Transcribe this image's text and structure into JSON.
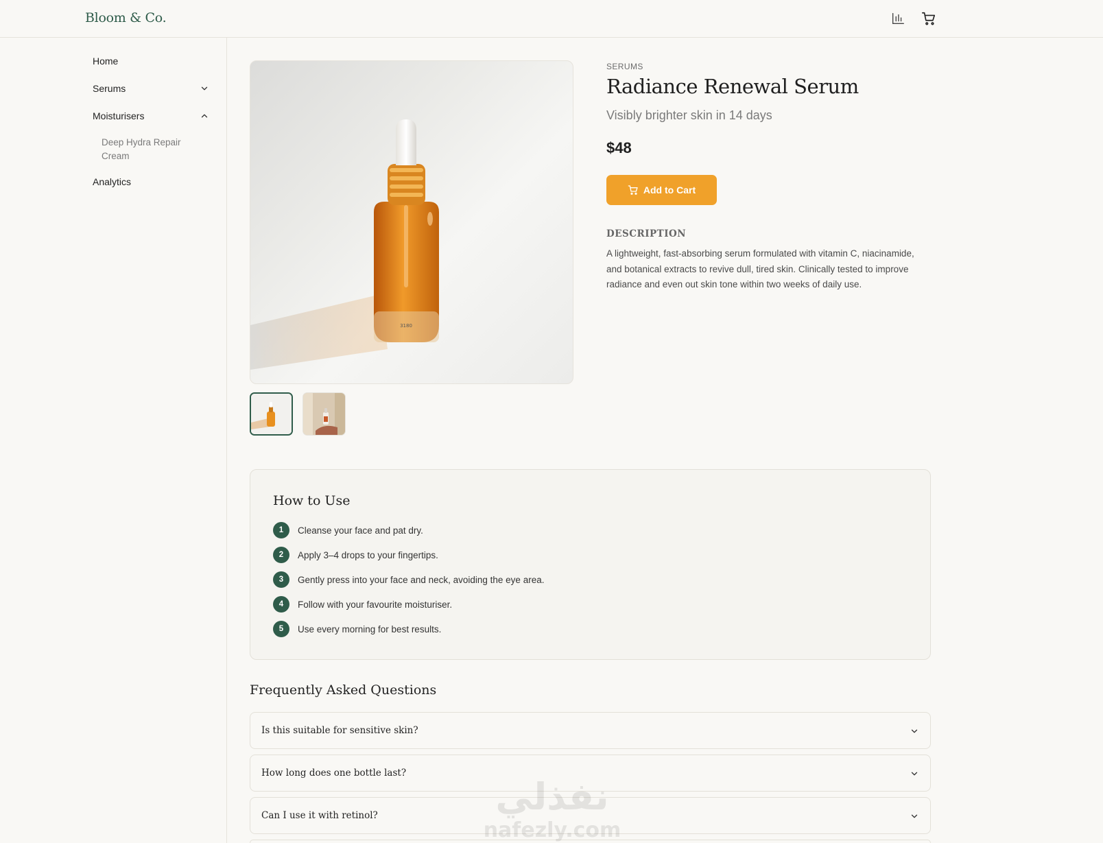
{
  "header": {
    "brand": "Bloom & Co.",
    "icons": [
      "analytics-icon",
      "cart-icon"
    ]
  },
  "sidebar": {
    "items": [
      {
        "label": "Home"
      },
      {
        "label": "Serums",
        "expanded": false
      },
      {
        "label": "Moisturisers",
        "expanded": true,
        "children": [
          "Deep Hydra Repair Cream"
        ]
      },
      {
        "label": "Analytics"
      }
    ]
  },
  "product": {
    "category": "SERUMS",
    "title": "Radiance Renewal Serum",
    "subtitle": "Visibly brighter skin in 14 days",
    "price": "$48",
    "add_to_cart": "Add to Cart",
    "bottle_label": "3180",
    "description_heading": "DESCRIPTION",
    "description": "A lightweight, fast-absorbing serum formulated with vitamin C, niacinamide, and botanical extracts to revive dull, tired skin. Clinically tested to improve radiance and even out skin tone within two weeks of daily use.",
    "thumbnail_count": 2,
    "active_thumbnail": 1
  },
  "how_to_use": {
    "title": "How to Use",
    "steps": [
      {
        "num": "1",
        "text": "Cleanse your face and pat dry."
      },
      {
        "num": "2",
        "text": "Apply 3–4 drops to your fingertips."
      },
      {
        "num": "3",
        "text": "Gently press into your face and neck, avoiding the eye area."
      },
      {
        "num": "4",
        "text": "Follow with your favourite moisturiser."
      },
      {
        "num": "5",
        "text": "Use every morning for best results."
      }
    ]
  },
  "faq": {
    "title": "Frequently Asked Questions",
    "items": [
      {
        "question": "Is this suitable for sensitive skin?"
      },
      {
        "question": "How long does one bottle last?"
      },
      {
        "question": "Can I use it with retinol?"
      }
    ]
  },
  "watermark": {
    "arabic": "نفذلي",
    "latin": "nafezly.com"
  },
  "colors": {
    "brand_green": "#2f5c4a",
    "accent_orange": "#f0a12a",
    "background": "#f9f8f5"
  }
}
